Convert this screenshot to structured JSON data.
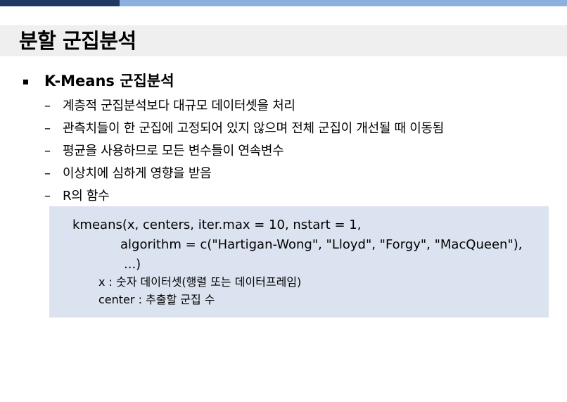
{
  "slide": {
    "title": "분할 군집분석",
    "main_bullet": "K-Means 군집분석",
    "sub_bullets": [
      "계층적 군집분석보다 대규모 데이터셋을 처리",
      "관측치들이 한 군집에 고정되어 있지 않으며 전체 군집이 개선될 때 이동됨",
      "평균을 사용하므로 모든 변수들이 연속변수",
      "이상치에 심하게 영향을 받음",
      "R의 함수"
    ],
    "dash_symbol": "–",
    "code": {
      "line1": "kmeans(x, centers, iter.max = 10, nstart = 1,",
      "line2": "algorithm = c(\"Hartigan-Wong\", \"Lloyd\", \"Forgy\", \"MacQueen\"),",
      "line3": "...)",
      "arg_x": "x  : 숫자 데이터셋(행렬 또는 데이터프레임)",
      "arg_center": "center :  추출할 군집 수"
    }
  },
  "colors": {
    "top_bar_dark": "#1f3864",
    "top_bar_light": "#8eb0e0",
    "title_band": "#efefef",
    "code_box": "#dce3f0"
  }
}
